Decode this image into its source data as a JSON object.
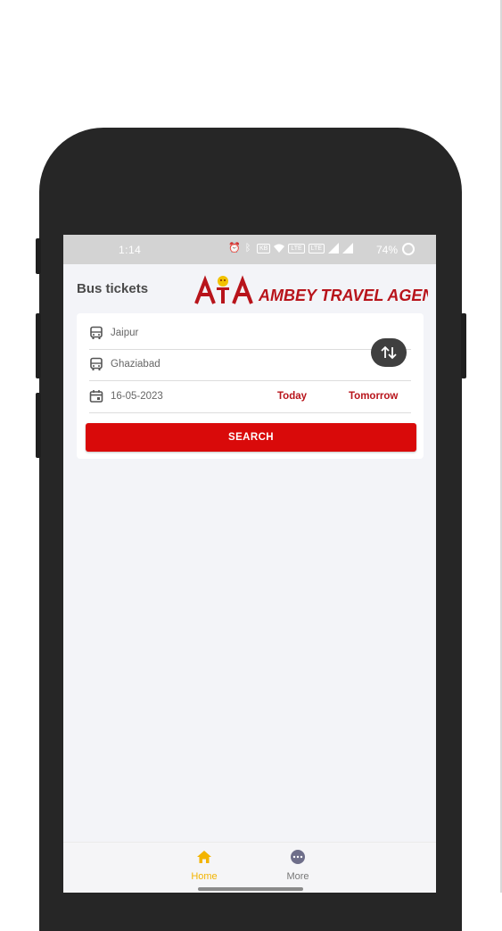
{
  "status_bar": {
    "time": "1:14",
    "battery": "74%"
  },
  "header": {
    "title": "Bus tickets",
    "logo_text": "AMBEY TRAVEL AGENCY",
    "logo_mark": "ATA"
  },
  "search_form": {
    "from": "Jaipur",
    "to": "Ghaziabad",
    "date": "16-05-2023",
    "today_label": "Today",
    "tomorrow_label": "Tomorrow",
    "search_label": "SEARCH"
  },
  "bottom_nav": {
    "items": [
      {
        "label": "Home",
        "icon": "home-icon",
        "active": true
      },
      {
        "label": "More",
        "icon": "more-icon",
        "active": false
      }
    ]
  },
  "colors": {
    "brand_red": "#b8141b",
    "search_red": "#d90a0a",
    "active_nav": "#f3b400"
  }
}
